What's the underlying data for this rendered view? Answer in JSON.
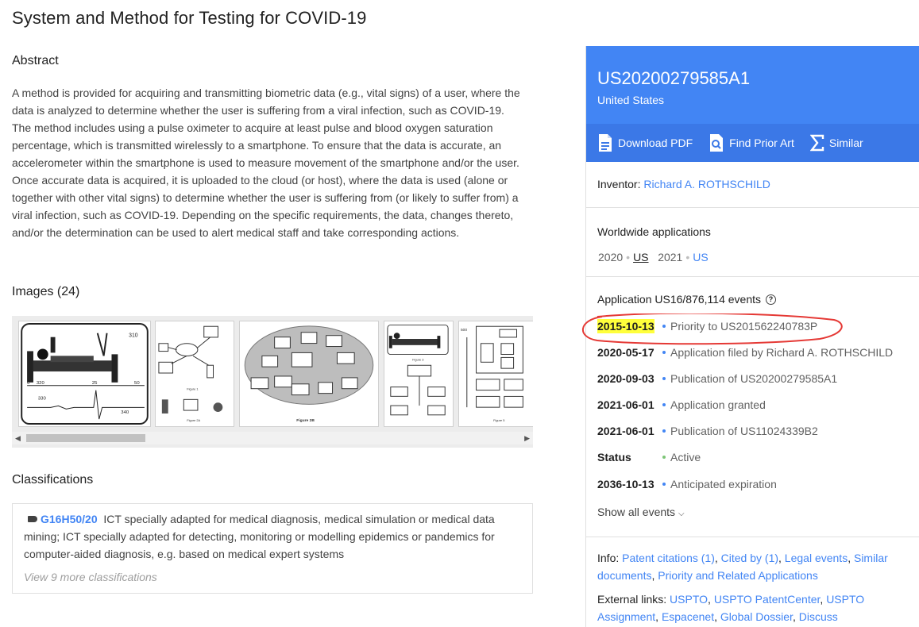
{
  "page": {
    "title": "System and Method for Testing for COVID-19"
  },
  "abstract": {
    "heading": "Abstract",
    "text": "A method is provided for acquiring and transmitting biometric data (e.g., vital signs) of a user, where the data is analyzed to determine whether the user is suffering from a viral infection, such as COVID-19. The method includes using a pulse oximeter to acquire at least pulse and blood oxygen saturation percentage, which is transmitted wirelessly to a smartphone. To ensure that the data is accurate, an accelerometer within the smartphone is used to measure movement of the smartphone and/or the user. Once accurate data is acquired, it is uploaded to the cloud (or host), where the data is used (alone or together with other vital signs) to determine whether the user is suffering from (or likely to suffer from) a viral infection, such as COVID-19. Depending on the specific requirements, the data, changes thereto, and/or the determination can be used to alert medical staff and take corresponding actions."
  },
  "images": {
    "heading": "Images (24)",
    "thumbnails": [
      {
        "icon": "patent-figure-bed-monitor",
        "labels": [
          "310",
          "320",
          "330",
          "340",
          "25",
          "50"
        ]
      },
      {
        "icon": "patent-figure-network",
        "labels": [
          "Figure 1",
          "Figure 2A"
        ]
      },
      {
        "icon": "patent-figure-block-diagram",
        "labels": [
          "Figure 2B"
        ]
      },
      {
        "icon": "patent-figure-bed-monitor-small",
        "labels": [
          "Figure 3"
        ]
      },
      {
        "icon": "patent-figure-flowchart",
        "labels": [
          "500",
          "Figure 5"
        ]
      }
    ]
  },
  "classifications": {
    "heading": "Classifications",
    "code": "G16H50/20",
    "description": "ICT specially adapted for medical diagnosis, medical simulation or medical data mining; ICT specially adapted for detecting, monitoring or modelling epidemics or pandemics for computer-aided diagnosis, e.g. based on medical expert systems",
    "more": "View 9 more classifications"
  },
  "publication": {
    "number": "US20200279585A1",
    "country": "United States",
    "header_color": "#4285f4",
    "actions": [
      {
        "label": "Download PDF",
        "icon": "pdf-icon"
      },
      {
        "label": "Find Prior Art",
        "icon": "prior-art-search-icon"
      },
      {
        "label": "Similar",
        "icon": "sigma-icon"
      }
    ]
  },
  "inventor": {
    "label": "Inventor:",
    "name": "Richard A. ROTHSCHILD"
  },
  "worldwide": {
    "heading": "Worldwide applications",
    "entries": [
      {
        "year": "2020",
        "country": "US"
      },
      {
        "year": "2021",
        "country": "US"
      }
    ]
  },
  "events": {
    "heading": "Application US16/876,114 events",
    "items": [
      {
        "date": "2015-10-13",
        "desc": "Priority to US201562240783P"
      },
      {
        "date": "2020-05-17",
        "desc": "Application filed by Richard A. ROTHSCHILD"
      },
      {
        "date": "2020-09-03",
        "desc": "Publication of US20200279585A1"
      },
      {
        "date": "2021-06-01",
        "desc": "Application granted"
      },
      {
        "date": "2021-06-01",
        "desc": "Publication of US11024339B2"
      },
      {
        "date": "Status",
        "desc": "Active"
      },
      {
        "date": "2036-10-13",
        "desc": "Anticipated expiration"
      }
    ],
    "show_all": "Show all events"
  },
  "info": {
    "label": "Info:",
    "links": [
      "Patent citations (1)",
      "Cited by (1)",
      "Legal events",
      "Similar documents",
      "Priority and Related Applications"
    ]
  },
  "external": {
    "label": "External links:",
    "links": [
      "USPTO",
      "USPTO PatentCenter",
      "USPTO Assignment",
      "Espacenet",
      "Global Dossier",
      "Discuss"
    ]
  },
  "annotation": {
    "highlight_color": "#ffff3b",
    "circle_color": "#e53935"
  }
}
